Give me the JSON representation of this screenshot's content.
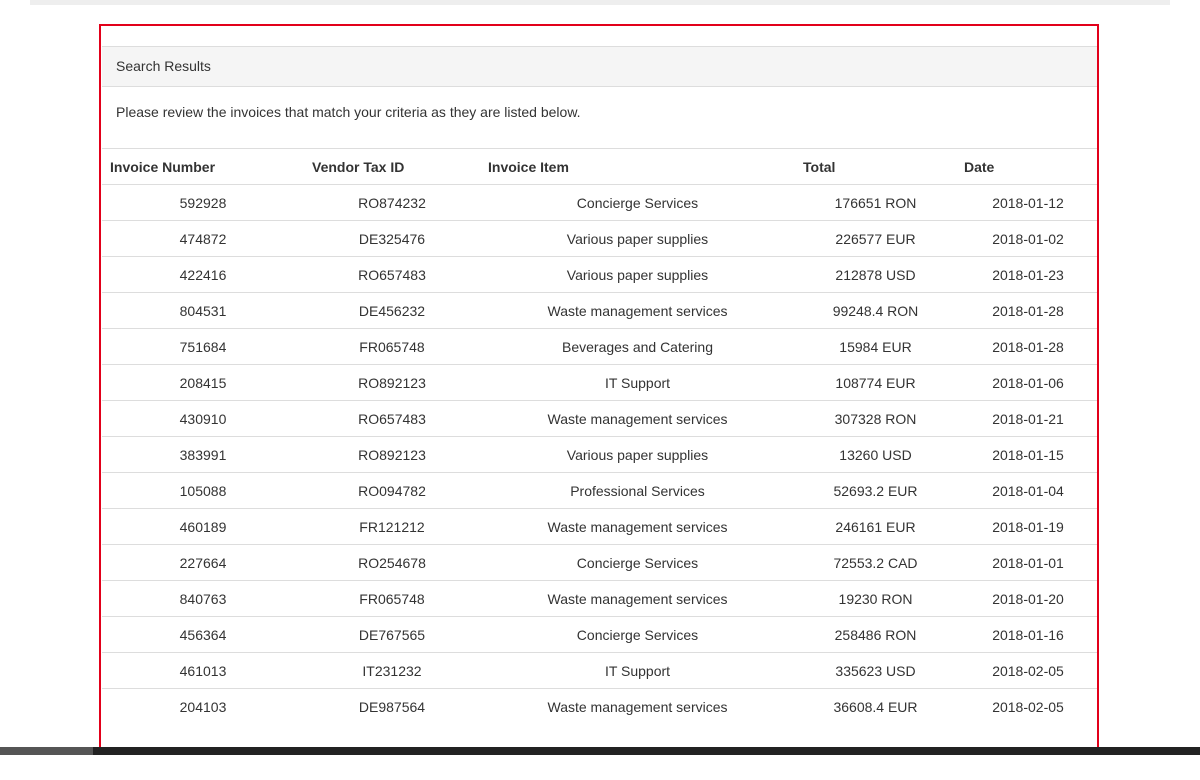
{
  "panel": {
    "heading": "Search Results",
    "intro": "Please review the invoices that match your criteria as they are listed below."
  },
  "table": {
    "headers": [
      "Invoice Number",
      "Vendor Tax ID",
      "Invoice Item",
      "Total",
      "Date"
    ],
    "rows": [
      [
        "592928",
        "RO874232",
        "Concierge Services",
        "176651 RON",
        "2018-01-12"
      ],
      [
        "474872",
        "DE325476",
        "Various paper supplies",
        "226577 EUR",
        "2018-01-02"
      ],
      [
        "422416",
        "RO657483",
        "Various paper supplies",
        "212878 USD",
        "2018-01-23"
      ],
      [
        "804531",
        "DE456232",
        "Waste management services",
        "99248.4 RON",
        "2018-01-28"
      ],
      [
        "751684",
        "FR065748",
        "Beverages and Catering",
        "15984 EUR",
        "2018-01-28"
      ],
      [
        "208415",
        "RO892123",
        "IT Support",
        "108774 EUR",
        "2018-01-06"
      ],
      [
        "430910",
        "RO657483",
        "Waste management services",
        "307328 RON",
        "2018-01-21"
      ],
      [
        "383991",
        "RO892123",
        "Various paper supplies",
        "13260 USD",
        "2018-01-15"
      ],
      [
        "105088",
        "RO094782",
        "Professional Services",
        "52693.2 EUR",
        "2018-01-04"
      ],
      [
        "460189",
        "FR121212",
        "Waste management services",
        "246161 EUR",
        "2018-01-19"
      ],
      [
        "227664",
        "RO254678",
        "Concierge Services",
        "72553.2 CAD",
        "2018-01-01"
      ],
      [
        "840763",
        "FR065748",
        "Waste management services",
        "19230 RON",
        "2018-01-20"
      ],
      [
        "456364",
        "DE767565",
        "Concierge Services",
        "258486 RON",
        "2018-01-16"
      ],
      [
        "461013",
        "IT231232",
        "IT Support",
        "335623 USD",
        "2018-02-05"
      ],
      [
        "204103",
        "DE987564",
        "Waste management services",
        "36608.4 EUR",
        "2018-02-05"
      ]
    ]
  },
  "colors": {
    "highlight_border": "#e2001a",
    "heading_background": "#f5f5f5",
    "row_border": "#dddddd",
    "text": "#333333"
  }
}
